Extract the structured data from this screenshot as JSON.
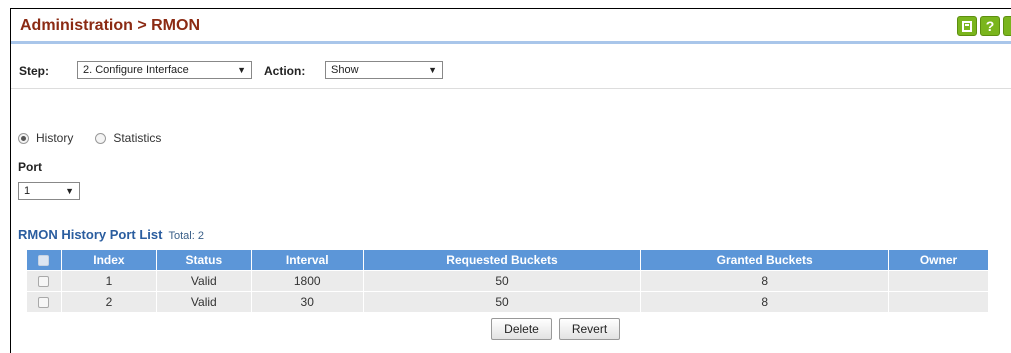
{
  "header": {
    "title": "Administration > RMON",
    "buttons": [
      {
        "name": "save-icon",
        "label": ""
      },
      {
        "name": "help-icon",
        "label": "?"
      }
    ]
  },
  "stepbar": {
    "step_label": "Step:",
    "step_value": "2. Configure Interface",
    "action_label": "Action:",
    "action_value": "Show"
  },
  "view": {
    "options": [
      {
        "label": "History",
        "selected": true
      },
      {
        "label": "Statistics",
        "selected": false
      }
    ]
  },
  "port": {
    "label": "Port",
    "value": "1"
  },
  "list": {
    "title": "RMON History Port List",
    "total": "Total: 2",
    "columns": [
      "Index",
      "Status",
      "Interval",
      "Requested Buckets",
      "Granted Buckets",
      "Owner"
    ],
    "rows": [
      {
        "index": "1",
        "status": "Valid",
        "interval": "1800",
        "requested": "50",
        "granted": "8",
        "owner": ""
      },
      {
        "index": "2",
        "status": "Valid",
        "interval": "30",
        "requested": "50",
        "granted": "8",
        "owner": ""
      }
    ]
  },
  "actions": {
    "delete": "Delete",
    "revert": "Revert"
  },
  "colors": {
    "title": "#8b2a13",
    "header_underline": "#a9c6ea",
    "table_header": "#5c96d8",
    "section_title": "#2a5d9f",
    "icon_green": "#7ab51d"
  }
}
